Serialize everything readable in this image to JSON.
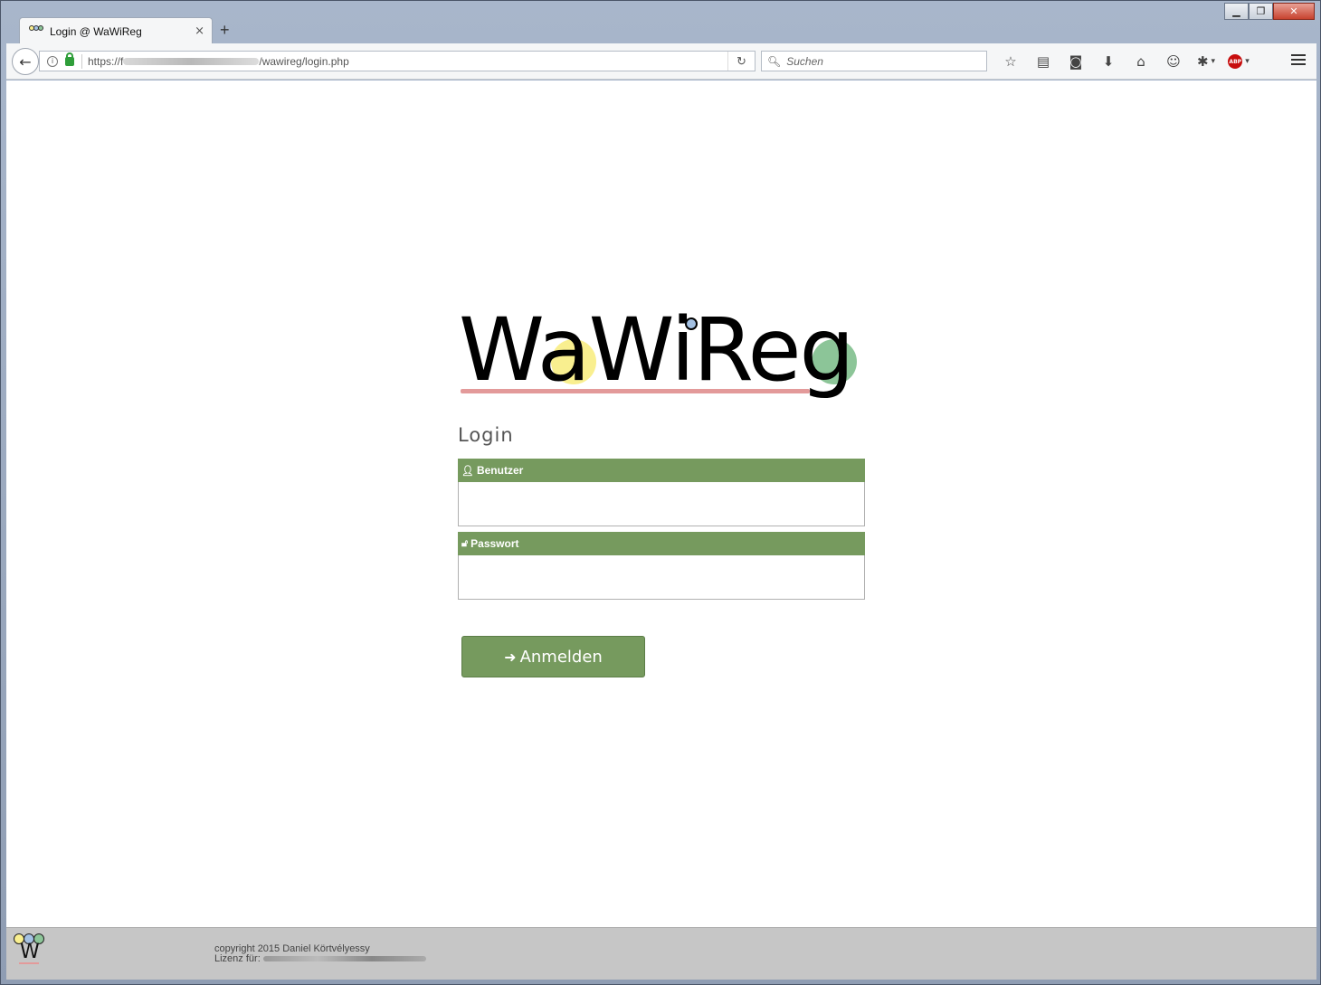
{
  "tab": {
    "title": "Login @ WaWiReg",
    "close": "×",
    "new_tab": "+"
  },
  "window_controls": {
    "minimize": "▁",
    "maximize": "❐",
    "close": "✕"
  },
  "navbar": {
    "url_prefix": "https://f",
    "url_suffix": "/wawireg/login.php",
    "search_placeholder": "Suchen",
    "icons": [
      "star-icon",
      "reading-list-icon",
      "pocket-icon",
      "download-icon",
      "home-icon",
      "chat-icon",
      "extension-icon",
      "adblock-icon",
      "menu-icon"
    ]
  },
  "logo": {
    "text": "WaWiReg",
    "colors": {
      "yellow": "#f9ef8f",
      "blue": "#a4c1e3",
      "green": "#8cc598",
      "underline": "#e39a9a"
    }
  },
  "login": {
    "title": "Login",
    "user_label": "Benutzer",
    "password_label": "Passwort",
    "user_value": "",
    "password_value": "",
    "submit_label": "Anmelden",
    "accent": "#769a5e"
  },
  "footer": {
    "copyright": "copyright 2015 Daniel Körtvélyessy",
    "license_label": "Lizenz für:"
  }
}
